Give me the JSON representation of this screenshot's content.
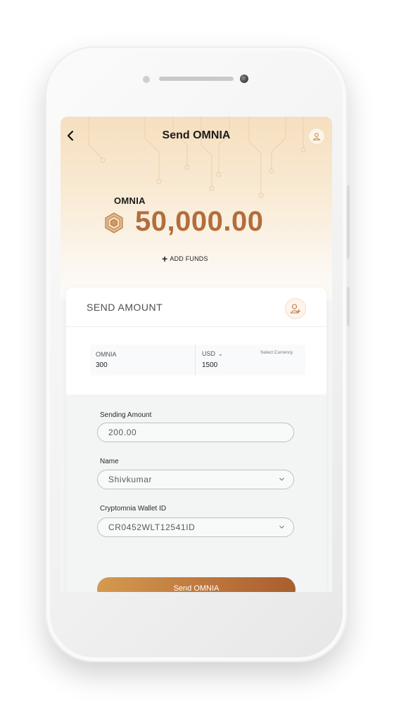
{
  "header": {
    "title": "Send OMNIA"
  },
  "balance": {
    "currency": "OMNIA",
    "amount": "50,000.00"
  },
  "add_funds": {
    "label": "ADD FUNDS"
  },
  "card": {
    "title": "SEND AMOUNT"
  },
  "converter": {
    "from_label": "OMNIA",
    "from_value": "300",
    "to_currency": "USD",
    "to_value": "1500",
    "select_label": "Select Currency"
  },
  "form": {
    "amount_label": "Sending Amount",
    "amount_value": "200.00",
    "name_label": "Name",
    "name_value": "Shivkumar",
    "wallet_label": "Cryptomnia Wallet ID",
    "wallet_value": "CR0452WLT12541ID"
  },
  "send_button": {
    "label": "Send OMNIA"
  },
  "colors": {
    "accent": "#b16e3c",
    "button_start": "#d49a4f",
    "button_end": "#a85e2f"
  },
  "icons": [
    "back-arrow-icon",
    "user-icon",
    "coin-icon",
    "plus-icon",
    "add-user-icon",
    "chevron-down-icon"
  ]
}
